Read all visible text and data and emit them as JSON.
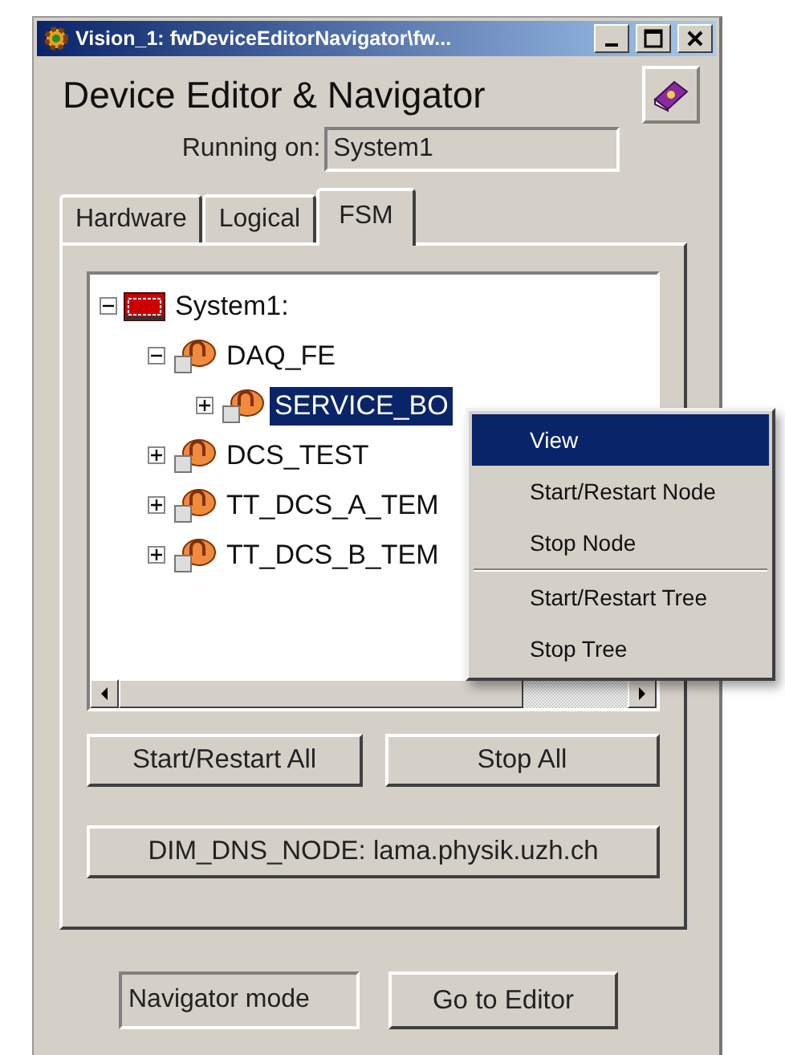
{
  "window": {
    "title": "Vision_1: fwDeviceEditorNavigator\\fw..."
  },
  "heading": "Device Editor & Navigator",
  "running_on": {
    "label": "Running on:",
    "value": "System1"
  },
  "tabs": [
    {
      "label": "Hardware",
      "selected": false
    },
    {
      "label": "Logical",
      "selected": false
    },
    {
      "label": "FSM",
      "selected": true
    }
  ],
  "tree": [
    {
      "label": "System1:",
      "kind": "system",
      "expanded": true,
      "selected": false,
      "children": [
        {
          "label": "DAQ_FE",
          "kind": "node",
          "expanded": true,
          "selected": false,
          "children": [
            {
              "label": "SERVICE_BO",
              "kind": "node",
              "expanded": false,
              "selected": true
            }
          ]
        },
        {
          "label": "DCS_TEST",
          "kind": "node",
          "expanded": false,
          "selected": false
        },
        {
          "label": "TT_DCS_A_TEM",
          "kind": "node",
          "expanded": false,
          "selected": false
        },
        {
          "label": "TT_DCS_B_TEM",
          "kind": "node",
          "expanded": false,
          "selected": false
        }
      ]
    }
  ],
  "buttons": [
    "Start/Restart All",
    "Stop All"
  ],
  "dns_button": "DIM_DNS_NODE: lama.physik.uzh.ch",
  "mode": {
    "value": "Navigator mode"
  },
  "editor_button": "Go to Editor",
  "context_menu": [
    {
      "kind": "item",
      "label": "View",
      "selected": true
    },
    {
      "kind": "item",
      "label": "Start/Restart Node",
      "selected": false
    },
    {
      "kind": "item",
      "label": "Stop Node",
      "selected": false
    },
    {
      "kind": "separator"
    },
    {
      "kind": "item",
      "label": "Start/Restart Tree",
      "selected": false
    },
    {
      "kind": "item",
      "label": "Stop Tree",
      "selected": false
    }
  ]
}
